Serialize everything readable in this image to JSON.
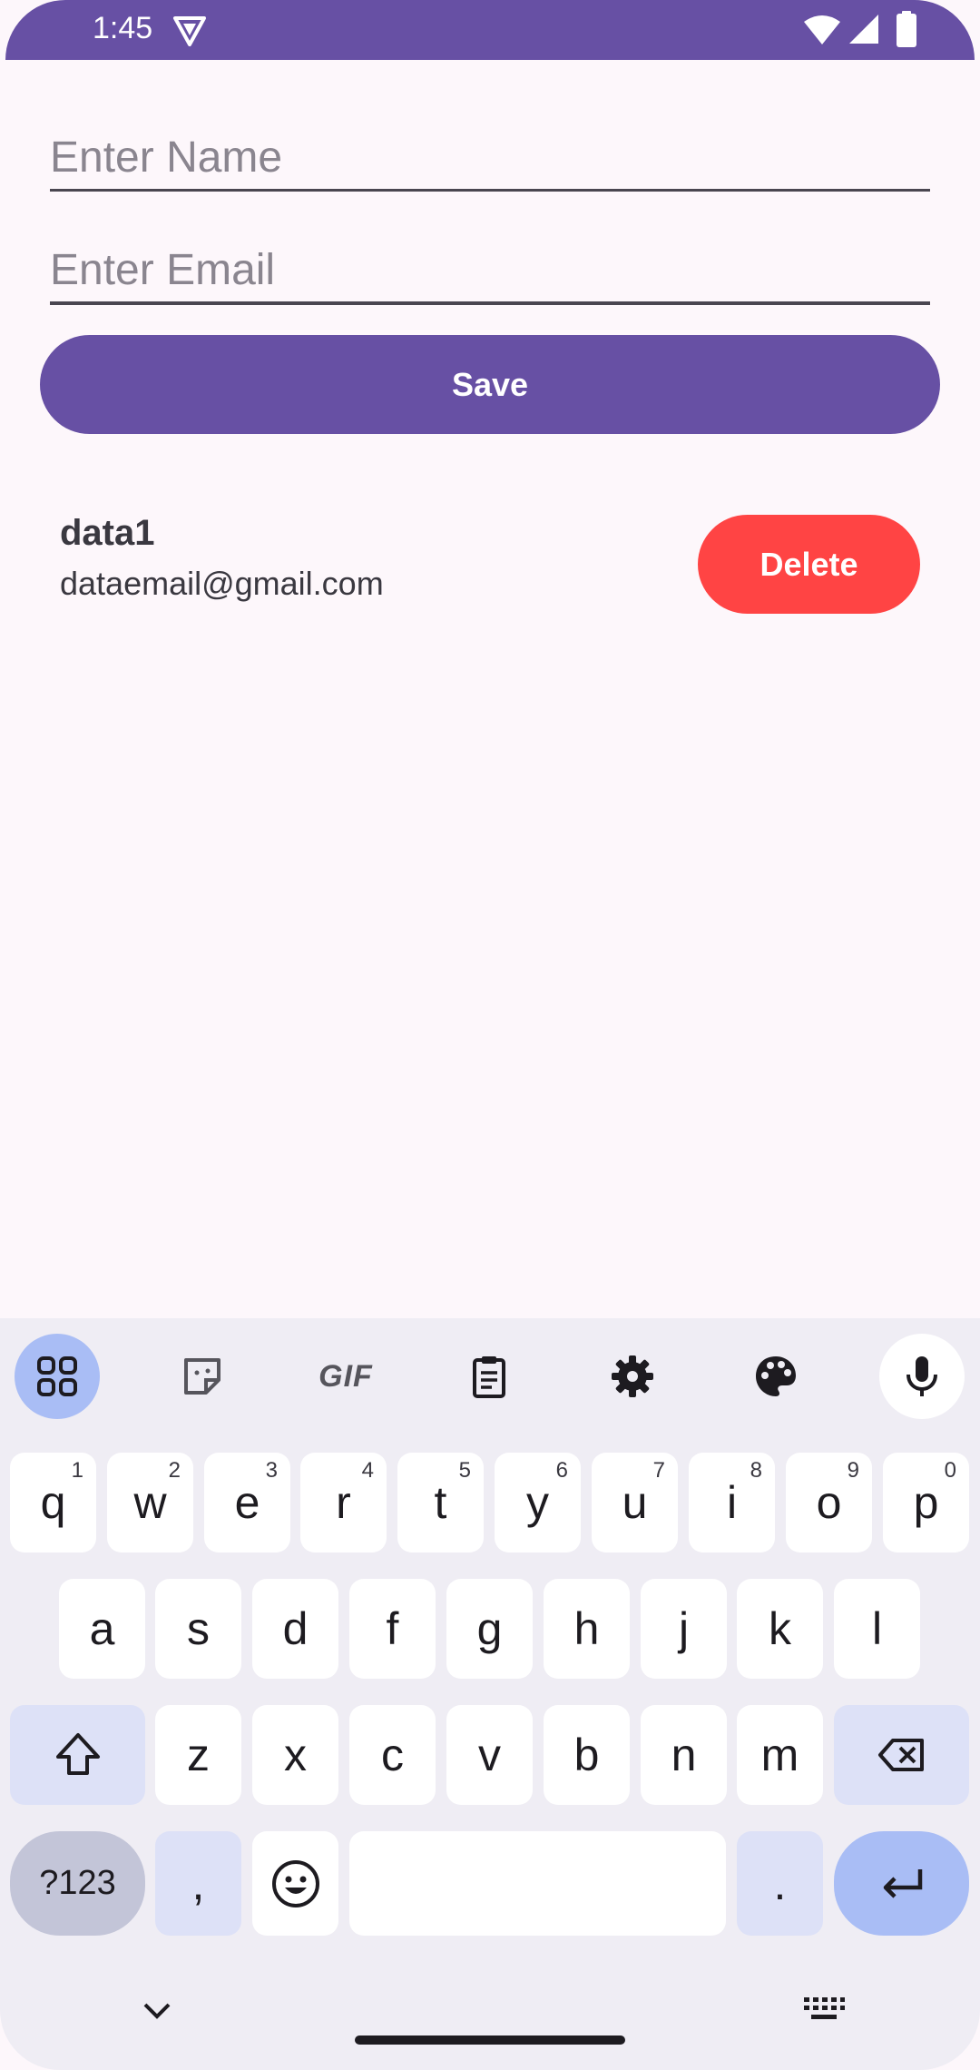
{
  "status_bar": {
    "time": "1:45"
  },
  "form": {
    "name_placeholder": "Enter Name",
    "name_value": "",
    "email_placeholder": "Enter Email",
    "email_value": "",
    "save_label": "Save"
  },
  "list": {
    "items": [
      {
        "name": "data1",
        "email": "dataemail@gmail.com",
        "delete_label": "Delete"
      }
    ]
  },
  "keyboard": {
    "toolbar": {
      "gif_label": "GIF"
    },
    "row1": [
      {
        "key": "q",
        "hint": "1"
      },
      {
        "key": "w",
        "hint": "2"
      },
      {
        "key": "e",
        "hint": "3"
      },
      {
        "key": "r",
        "hint": "4"
      },
      {
        "key": "t",
        "hint": "5"
      },
      {
        "key": "y",
        "hint": "6"
      },
      {
        "key": "u",
        "hint": "7"
      },
      {
        "key": "i",
        "hint": "8"
      },
      {
        "key": "o",
        "hint": "9"
      },
      {
        "key": "p",
        "hint": "0"
      }
    ],
    "row2": [
      "a",
      "s",
      "d",
      "f",
      "g",
      "h",
      "j",
      "k",
      "l"
    ],
    "row3": [
      "z",
      "x",
      "c",
      "v",
      "b",
      "n",
      "m"
    ],
    "row4": {
      "symbols": "?123",
      "comma": ",",
      "period": "."
    }
  },
  "colors": {
    "primary": "#6750a4",
    "delete": "#ff4444",
    "background": "#fdf7fb",
    "keyboard_bg": "#efedf4",
    "accent_key": "#a9bdf5"
  }
}
